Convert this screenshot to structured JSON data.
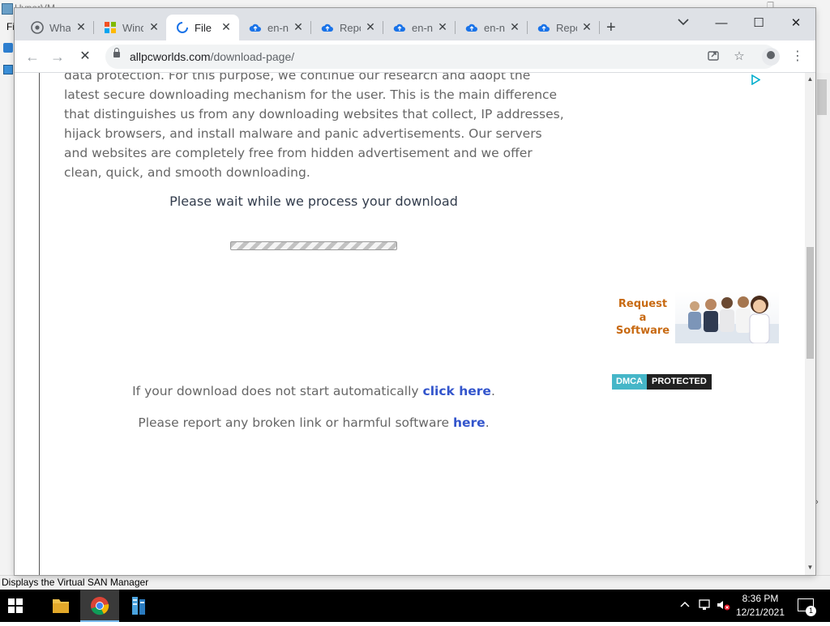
{
  "background_app": {
    "window_title": "HyperVM",
    "menu_text": "Fi",
    "status_text": "Displays the Virtual SAN Manager"
  },
  "browser": {
    "tabs": [
      {
        "label": "Wha",
        "icon": "chrome-icon",
        "active": false
      },
      {
        "label": "Wind",
        "icon": "windows-logo-icon",
        "active": false
      },
      {
        "label": "File",
        "icon": "loading-spinner-icon",
        "active": true
      },
      {
        "label": "en-n",
        "icon": "cloud-icon",
        "active": false
      },
      {
        "label": "Repo",
        "icon": "cloud-icon",
        "active": false
      },
      {
        "label": "en-n",
        "icon": "cloud-icon",
        "active": false
      },
      {
        "label": "en-n",
        "icon": "cloud-icon",
        "active": false
      },
      {
        "label": "Repo",
        "icon": "cloud-icon",
        "active": false
      }
    ],
    "address": {
      "domain": "allpcworlds.com",
      "path": "/download-page/"
    }
  },
  "page": {
    "intro_text": "data protection. For this purpose, we continue our research and adopt the latest secure downloading mechanism for the user. This is the main difference that distinguishes us from any downloading websites that collect, IP addresses, hijack browsers, and install malware and panic advertisements. Our servers and websites are completely free from hidden advertisement and we offer clean, quick, and smooth downloading.",
    "wait_message": "Please wait while we process your download",
    "auto_prefix": "If your download does not start automatically ",
    "auto_link": "click here",
    "auto_suffix": ".",
    "report_prefix": "Please report any broken link or harmful software ",
    "report_link": "here",
    "report_suffix": "."
  },
  "sidebar": {
    "request_banner_text": [
      "Request",
      "a",
      "Software"
    ],
    "dmca_left": "DMCA",
    "dmca_right": "PROTECTED"
  },
  "taskbar": {
    "time": "8:36 PM",
    "date": "12/21/2021",
    "notification_count": "1"
  },
  "colors": {
    "link": "#3355cc",
    "banner_text": "#c86a12",
    "dmca_teal": "#45b6c8"
  }
}
